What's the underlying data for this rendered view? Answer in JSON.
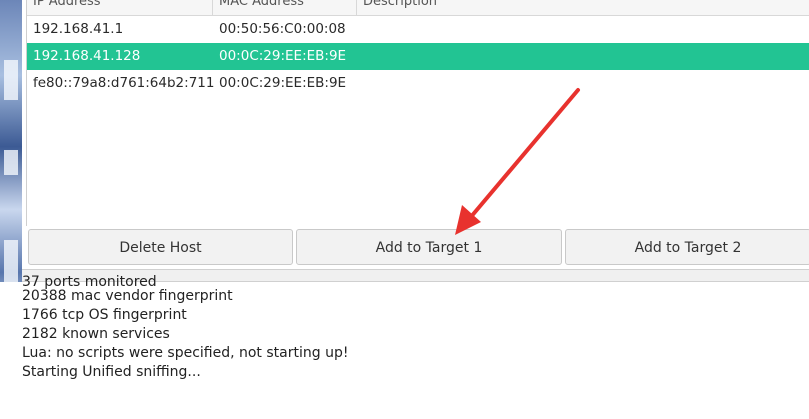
{
  "host_table": {
    "columns": [
      "IP Address",
      "MAC Address",
      "Description"
    ],
    "rows": [
      {
        "ip": "192.168.41.1",
        "mac": "00:50:56:C0:00:08",
        "description": "",
        "selected": false
      },
      {
        "ip": "192.168.41.128",
        "mac": "00:0C:29:EE:EB:9E",
        "description": "",
        "selected": true
      },
      {
        "ip": "fe80::79a8:d761:64b2:711",
        "mac": "00:0C:29:EE:EB:9E",
        "description": "",
        "selected": false
      }
    ],
    "selected_color": "#22c493"
  },
  "buttons": {
    "delete_host": "Delete Host",
    "add_target_1": "Add to Target 1",
    "add_target_2": "Add to Target 2"
  },
  "log": {
    "partial_line": "37 ports monitored",
    "lines": [
      "20388 mac vendor fingerprint",
      "1766 tcp OS fingerprint",
      "2182 known services",
      "Lua: no scripts were specified, not starting up!",
      "Starting Unified sniffing..."
    ]
  },
  "annotation": {
    "arrow_color": "#e8322e",
    "arrow_target": "add_target_1"
  }
}
